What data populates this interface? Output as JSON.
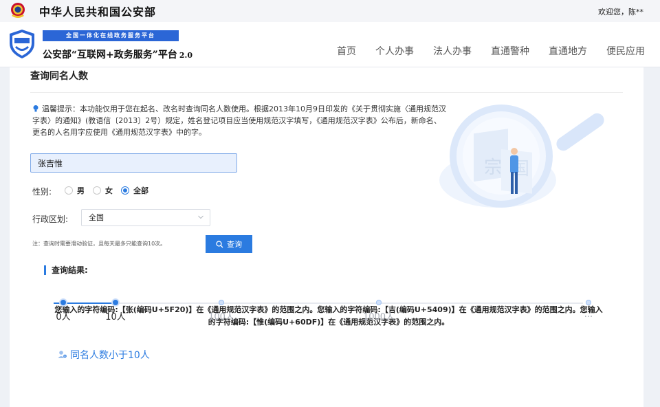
{
  "gov": {
    "title": "中华人民共和国公安部",
    "welcome": "欢迎您，陈**"
  },
  "header": {
    "platform_tag": "全国一体化在线政务服务平台",
    "platform_name": "公安部“互联网+政务服务”平台",
    "version": "2.0",
    "nav": [
      "首页",
      "个人办事",
      "法人办事",
      "直通警种",
      "直通地方",
      "便民应用"
    ]
  },
  "page": {
    "title": "查询同名人数",
    "tip": "温馨提示：本功能仅用于您在起名、改名时查询同名人数使用。根据2013年10月9日印发的《关于贯彻实施〈通用规范汉字表〉的通知》(教语信〔2013〕2号）规定，姓名登记项目应当使用规范汉字填写，《通用规范汉字表》公布后，新命名、更名的人名用字应使用《通用规范汉字表》中的字。",
    "name_value": "张吉惟",
    "gender_label": "性别:",
    "gender_options": [
      "男",
      "女",
      "全部"
    ],
    "gender_selected": "全部",
    "region_label": "行政区划:",
    "region_value": "全国",
    "note": "注：查询时需要滑动验证，且每天最多只能查询10次。",
    "search_label": "查询"
  },
  "results": {
    "title": "查询结果:",
    "text": "您输入的字符编码:【张(编码U+5F20)】在《通用规范汉字表》的范围之内。您输入的字符编码:【吉(编码U+5409)】在《通用规范汉字表》的范围之内。您输入的字符编码:【惟(编码U+60DF)】在《通用规范汉字表》的范围之内。",
    "count_text": "同名人数小于10人",
    "scale_labels": [
      "0人",
      "10人",
      "100人",
      "1000人",
      "..."
    ],
    "active_index": 1
  },
  "colors": {
    "accent": "#2b7be0",
    "brand_blue": "#2b66d6"
  }
}
